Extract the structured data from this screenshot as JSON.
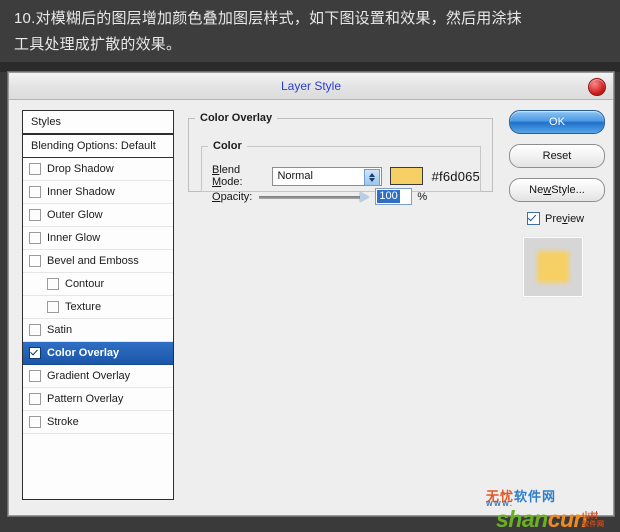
{
  "tutorial": {
    "text": "10.对模糊后的图层增加颜色叠加图层样式，如下图设置和效果，然后用涂抹\n工具处理成扩散的效果。"
  },
  "dialog": {
    "title": "Layer Style",
    "close_label": "×"
  },
  "styles_panel": {
    "header": "Styles",
    "blending_options": "Blending Options: Default",
    "items": [
      {
        "label": "Drop Shadow",
        "checked": false,
        "indent": false,
        "selected": false
      },
      {
        "label": "Inner Shadow",
        "checked": false,
        "indent": false,
        "selected": false
      },
      {
        "label": "Outer Glow",
        "checked": false,
        "indent": false,
        "selected": false
      },
      {
        "label": "Inner Glow",
        "checked": false,
        "indent": false,
        "selected": false
      },
      {
        "label": "Bevel and Emboss",
        "checked": false,
        "indent": false,
        "selected": false
      },
      {
        "label": "Contour",
        "checked": false,
        "indent": true,
        "selected": false
      },
      {
        "label": "Texture",
        "checked": false,
        "indent": true,
        "selected": false
      },
      {
        "label": "Satin",
        "checked": false,
        "indent": false,
        "selected": false
      },
      {
        "label": "Color Overlay",
        "checked": true,
        "indent": false,
        "selected": true
      },
      {
        "label": "Gradient Overlay",
        "checked": false,
        "indent": false,
        "selected": false
      },
      {
        "label": "Pattern Overlay",
        "checked": false,
        "indent": false,
        "selected": false
      },
      {
        "label": "Stroke",
        "checked": false,
        "indent": false,
        "selected": false
      }
    ]
  },
  "settings": {
    "group_title": "Color Overlay",
    "subgroup_title": "Color",
    "blend_mode_label": "Blend Mode:",
    "blend_mode_value": "Normal",
    "color_hex": "#f6d065",
    "swatch_color": "#f6d065",
    "opacity_label": "Opacity:",
    "opacity_value": "100",
    "opacity_unit": "%"
  },
  "buttons": {
    "ok": "OK",
    "reset": "Reset",
    "new_style": "New Style...",
    "preview_label": "Preview",
    "preview_checked": true
  },
  "watermark": {
    "cn_text": "无忧软件网",
    "www": "WWW.",
    "main": "shancun",
    "sub": "山村",
    "sub2": "软件网"
  },
  "colors": {
    "accent_blue": "#1b56a8",
    "title_blue": "#2c3fd0",
    "overlay_color": "#f6d065",
    "page_bg": "#3d3d3d",
    "dialog_bg": "#eeeeee"
  }
}
